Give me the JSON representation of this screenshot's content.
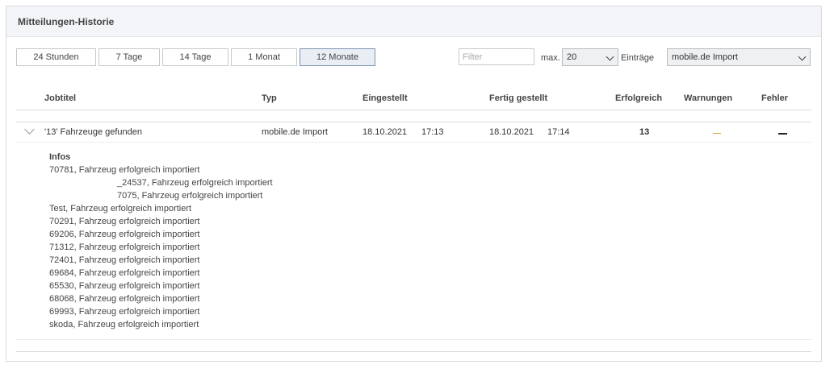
{
  "panel": {
    "title": "Mitteilungen-Historie"
  },
  "ranges": [
    {
      "label": "24 Stunden",
      "active": false
    },
    {
      "label": "7 Tage",
      "active": false
    },
    {
      "label": "14 Tage",
      "active": false
    },
    {
      "label": "1 Monat",
      "active": false
    },
    {
      "label": "12 Monate",
      "active": true
    }
  ],
  "filter": {
    "placeholder": "Filter",
    "value": ""
  },
  "max": {
    "label": "max.",
    "value": "20",
    "suffix": "Einträge"
  },
  "source": {
    "value": "mobile.de Import"
  },
  "table": {
    "headers": {
      "jobtitel": "Jobtitel",
      "typ": "Typ",
      "eingestellt": "Eingestellt",
      "fertig": "Fertig gestellt",
      "erfolgreich": "Erfolgreich",
      "warnungen": "Warnungen",
      "fehler": "Fehler"
    },
    "row": {
      "jobtitel": "'13' Fahrzeuge gefunden",
      "typ": "mobile.de Import",
      "eingestellt_date": "18.10.2021",
      "eingestellt_time": "17:13",
      "fertig_date": "18.10.2021",
      "fertig_time": "17:14",
      "erfolgreich": "13"
    },
    "details": {
      "title": "Infos",
      "lines": [
        {
          "text": "70781, Fahrzeug erfolgreich importiert",
          "indent": false
        },
        {
          "text": "_24537, Fahrzeug erfolgreich importiert",
          "indent": true
        },
        {
          "text": "7075, Fahrzeug erfolgreich importiert",
          "indent": true
        },
        {
          "text": "Test, Fahrzeug erfolgreich importiert",
          "indent": false
        },
        {
          "text": "70291, Fahrzeug erfolgreich importiert",
          "indent": false
        },
        {
          "text": "69206, Fahrzeug erfolgreich importiert",
          "indent": false
        },
        {
          "text": "71312, Fahrzeug erfolgreich importiert",
          "indent": false
        },
        {
          "text": "72401, Fahrzeug erfolgreich importiert",
          "indent": false
        },
        {
          "text": "69684, Fahrzeug erfolgreich importiert",
          "indent": false
        },
        {
          "text": "65530, Fahrzeug erfolgreich importiert",
          "indent": false
        },
        {
          "text": "68068, Fahrzeug erfolgreich importiert",
          "indent": false
        },
        {
          "text": "69993, Fahrzeug erfolgreich importiert",
          "indent": false
        },
        {
          "text": "skoda, Fahrzeug erfolgreich importiert",
          "indent": false
        }
      ]
    }
  },
  "colors": {
    "warning": "#e0a040",
    "error": "#222222",
    "active_border": "#7f94b0"
  }
}
